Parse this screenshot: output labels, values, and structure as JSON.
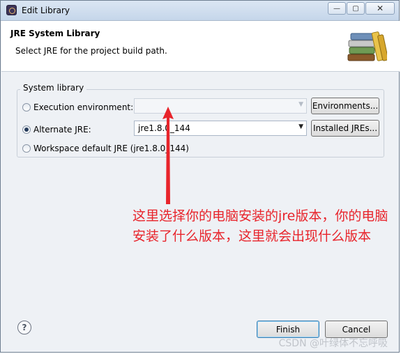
{
  "window": {
    "title": "Edit Library",
    "minimize": "—",
    "restore": "▢",
    "close": "✕"
  },
  "header": {
    "title": "JRE System Library",
    "description": "Select JRE for the project build path."
  },
  "group": {
    "label": "System library",
    "execution_env": {
      "label": "Execution environment:",
      "value": "",
      "button": "Environments...",
      "selected": false
    },
    "alternate_jre": {
      "label": "Alternate JRE:",
      "value": "jre1.8.0_144",
      "button": "Installed JREs...",
      "selected": true
    },
    "workspace_default": {
      "label": "Workspace default JRE (jre1.8.0_144)",
      "selected": false
    }
  },
  "annotation": {
    "text": "这里选择你的电脑安装的jre版本，你的电脑安装了什么版本，这里就会出现什么版本",
    "color": "#e8242b"
  },
  "footer": {
    "help": "?",
    "finish": "Finish",
    "cancel": "Cancel"
  },
  "watermark": "CSDN @叶绿体不忘呼吸",
  "icons": [
    "app-icon",
    "books-icon",
    "help-icon",
    "arrow-annotation"
  ]
}
